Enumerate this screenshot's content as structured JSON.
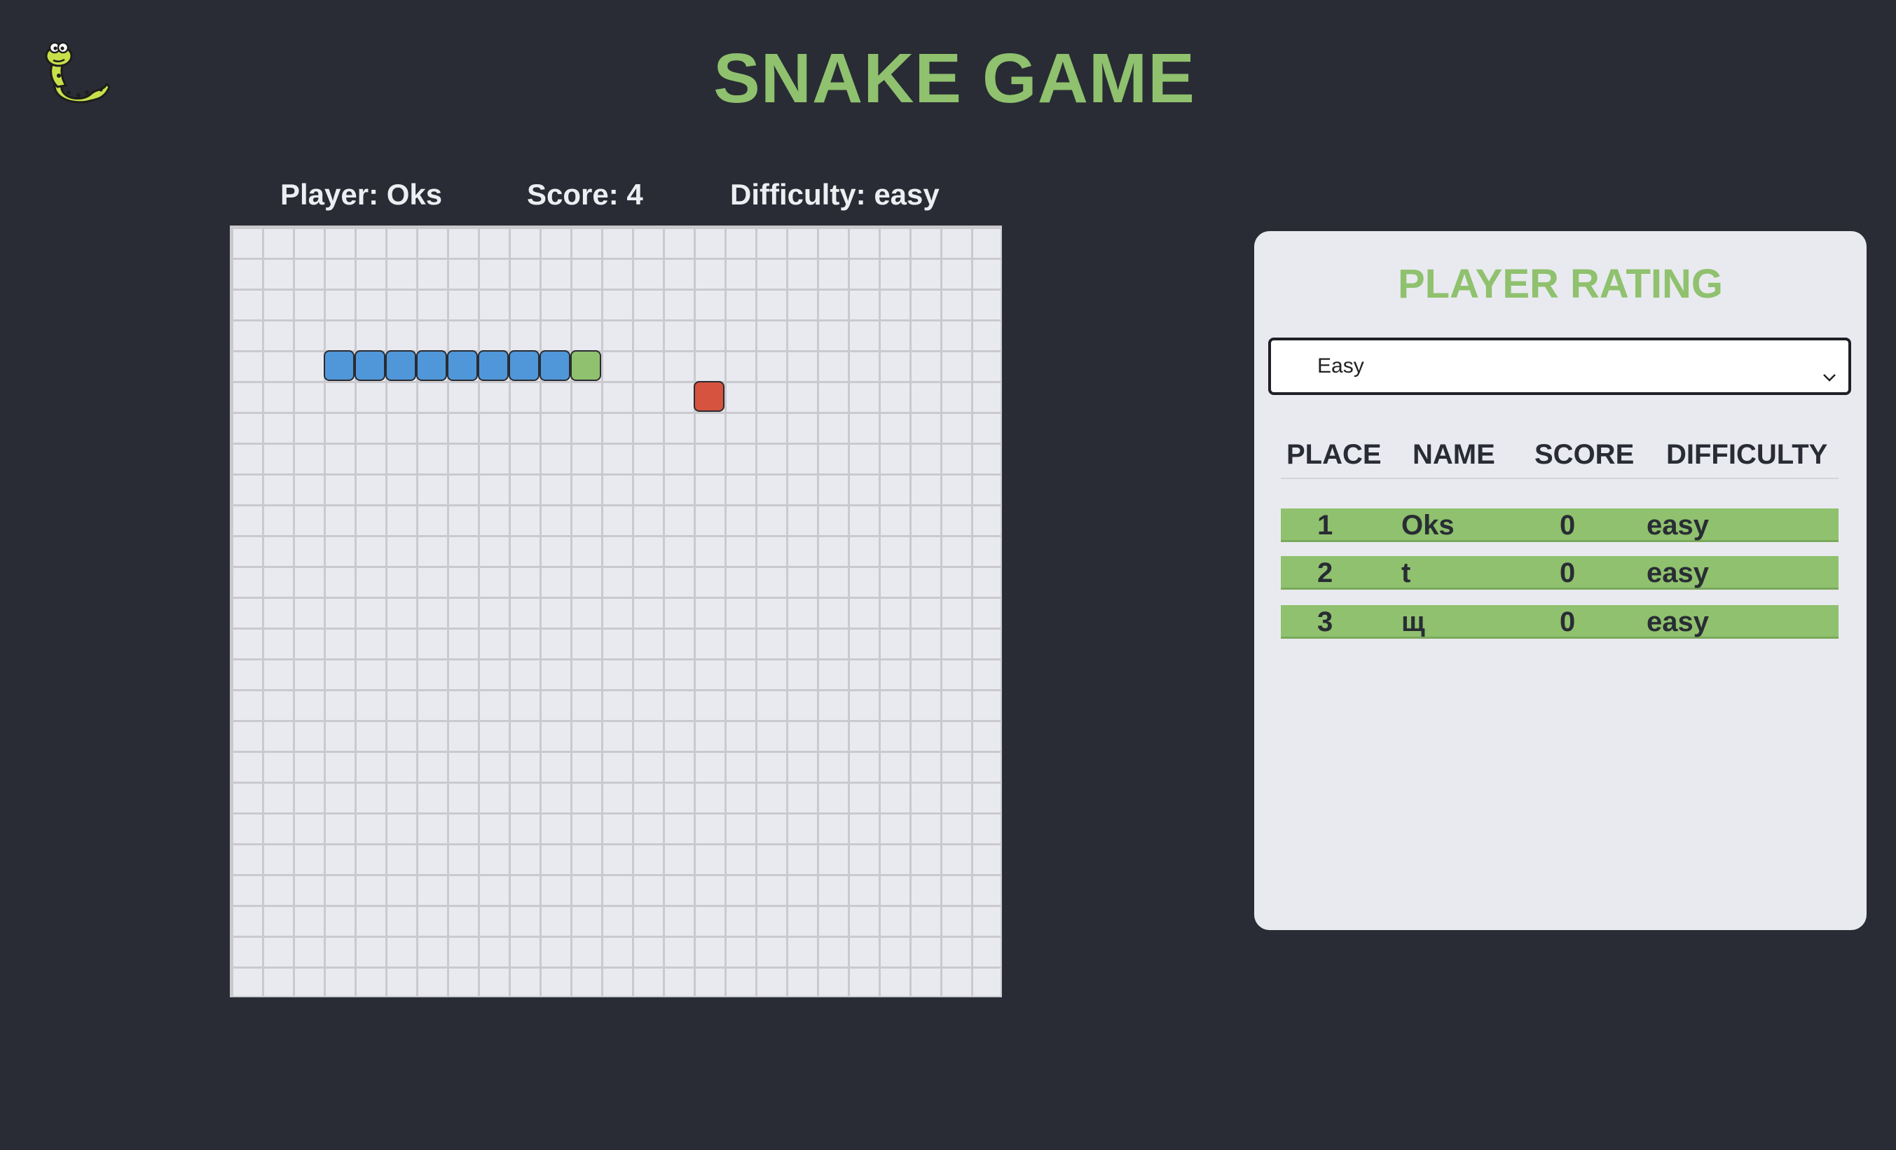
{
  "header": {
    "title": "SNAKE GAME",
    "logo_icon": "snake-logo-icon"
  },
  "stats": {
    "player": "Player: Oks",
    "score": "Score: 4",
    "difficulty": "Difficulty: easy"
  },
  "board": {
    "columns": 25,
    "rows": 25,
    "snake_body": [
      [
        3,
        4
      ],
      [
        4,
        4
      ],
      [
        5,
        4
      ],
      [
        6,
        4
      ],
      [
        7,
        4
      ],
      [
        8,
        4
      ],
      [
        9,
        4
      ],
      [
        10,
        4
      ]
    ],
    "snake_head": [
      11,
      4
    ],
    "food": [
      15,
      5
    ],
    "colors": {
      "body": "#4f97d9",
      "head": "#8fc16e",
      "food": "#d6533f",
      "grid": "#c9c9ce",
      "board_bg": "#e9eaef"
    }
  },
  "rating": {
    "title": "PLAYER RATING",
    "select": {
      "selected": "Easy"
    },
    "columns": [
      "PLACE",
      "NAME",
      "SCORE",
      "DIFFICULTY"
    ],
    "rows": [
      {
        "place": "1",
        "name": "Oks",
        "score": "0",
        "difficulty": "easy"
      },
      {
        "place": "2",
        "name": "t",
        "score": "0",
        "difficulty": "easy"
      },
      {
        "place": "3",
        "name": "щ",
        "score": "0",
        "difficulty": "easy"
      }
    ]
  },
  "theme": {
    "background": "#292c34",
    "accent": "#8fc16e",
    "panel": "#e9eaef"
  }
}
